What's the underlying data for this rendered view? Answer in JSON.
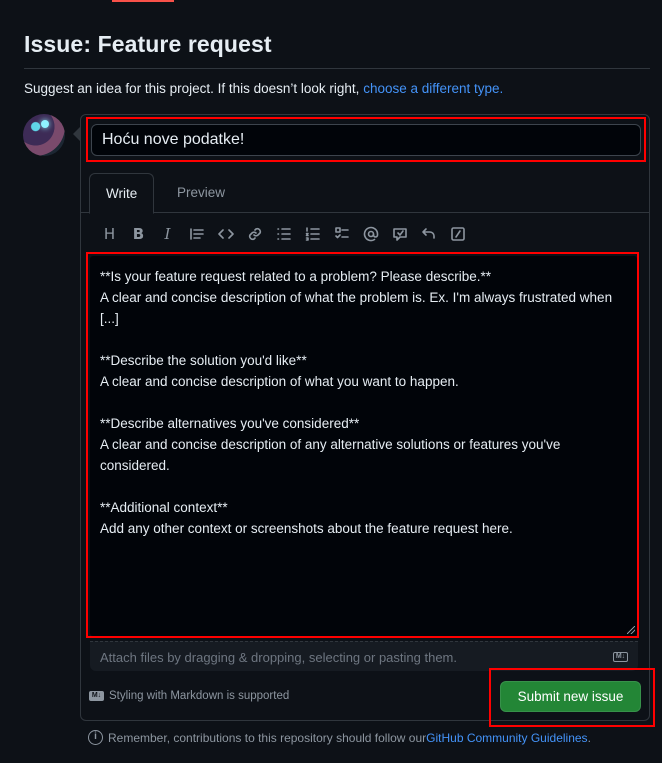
{
  "page": {
    "title": "Issue: Feature request",
    "subtitle_text": "Suggest an idea for this project. If this doesn’t look right, ",
    "subtitle_link": "choose a different type."
  },
  "issue_title": {
    "value": "Hoću nove podatke!"
  },
  "tabs": {
    "write": "Write",
    "preview": "Preview"
  },
  "toolbar": {
    "icons": [
      "heading-icon",
      "bold-icon",
      "italic-icon",
      "quote-icon",
      "code-icon",
      "link-icon",
      "unordered-list-icon",
      "ordered-list-icon",
      "task-list-icon",
      "mention-icon",
      "reference-icon",
      "undo-icon",
      "slash-commands-icon"
    ],
    "heading": "H",
    "bold": "B",
    "italic": "I"
  },
  "body": {
    "lines": [
      "**Is your feature request related to a problem? Please describe.**",
      "A clear and concise description of what the problem is. Ex. I'm always frustrated when [...]",
      "",
      "**Describe the solution you'd like**",
      "A clear and concise description of what you want to happen.",
      "",
      "**Describe alternatives you've considered**",
      "A clear and concise description of any alternative solutions or features you've considered.",
      "",
      "**Additional context**",
      "Add any other context or screenshots about the feature request here."
    ]
  },
  "attach": {
    "text": "Attach files by dragging & dropping, selecting or pasting them.",
    "md_badge": "M↓"
  },
  "markdown_note": {
    "text": "Styling with Markdown is supported",
    "badge": "M↓"
  },
  "submit": {
    "label": "Submit new issue"
  },
  "footer": {
    "text": "Remember, contributions to this repository should follow our ",
    "link": "GitHub Community Guidelines",
    "end": ".",
    "icon": "i"
  },
  "colors": {
    "accent_link": "#4493f8",
    "submit_green": "#238636",
    "highlight_red": "#ff0000",
    "background": "#0d1117"
  }
}
